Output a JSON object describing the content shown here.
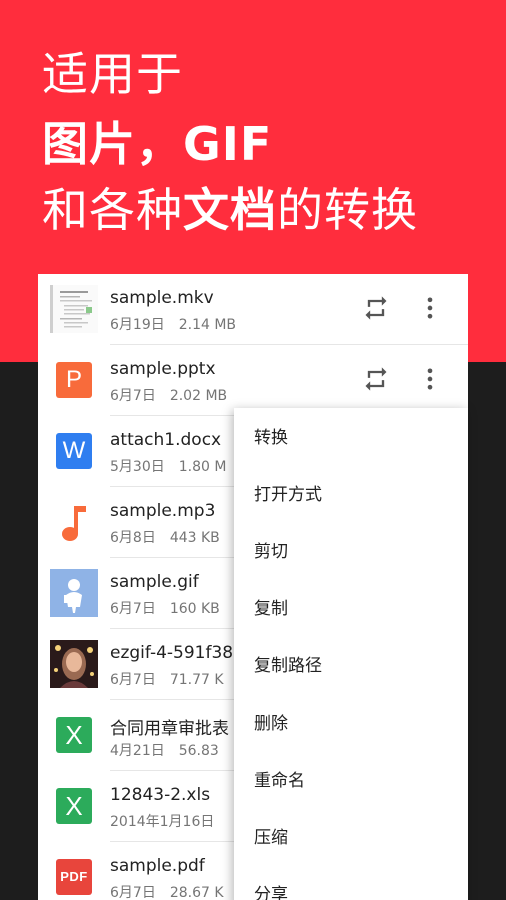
{
  "hero": {
    "line1": "适用于",
    "line2": "图片，GIF",
    "line3_part1": "和各种",
    "line3_bold": "文档",
    "line3_part2": "的转换"
  },
  "files": [
    {
      "name": "sample.mkv",
      "date": "6月19日",
      "size": "2.14 MB",
      "icon": "document-thumbnail-icon"
    },
    {
      "name": "sample.pptx",
      "date": "6月7日",
      "size": "2.02 MB",
      "icon": "powerpoint-icon",
      "letter": "P"
    },
    {
      "name": "attach1.docx",
      "date": "5月30日",
      "size": "1.80 M",
      "icon": "word-icon",
      "letter": "W"
    },
    {
      "name": "sample.mp3",
      "date": "6月8日",
      "size": "443 KB",
      "icon": "music-note-icon"
    },
    {
      "name": "sample.gif",
      "date": "6月7日",
      "size": "160 KB",
      "icon": "gif-thumbnail-icon"
    },
    {
      "name": "ezgif-4-591f38",
      "date": "6月7日",
      "size": "71.77 K",
      "icon": "portrait-thumbnail-icon"
    },
    {
      "name": "合同用章审批表",
      "date": "4月21日",
      "size": "56.83",
      "icon": "excel-icon",
      "letter": "X"
    },
    {
      "name": "12843-2.xls",
      "date": "2014年1月16日",
      "size": "",
      "icon": "excel-icon",
      "letter": "X"
    },
    {
      "name": "sample.pdf",
      "date": "6月7日",
      "size": "28.67 K",
      "icon": "pdf-icon",
      "letter": "PDF"
    }
  ],
  "menu": {
    "items": [
      "转换",
      "打开方式",
      "剪切",
      "复制",
      "复制路径",
      "删除",
      "重命名",
      "压缩",
      "分享"
    ]
  },
  "colors": {
    "accent": "#ff2d3d",
    "background_dark": "#1d1d1d",
    "action_icon": "#555555"
  }
}
